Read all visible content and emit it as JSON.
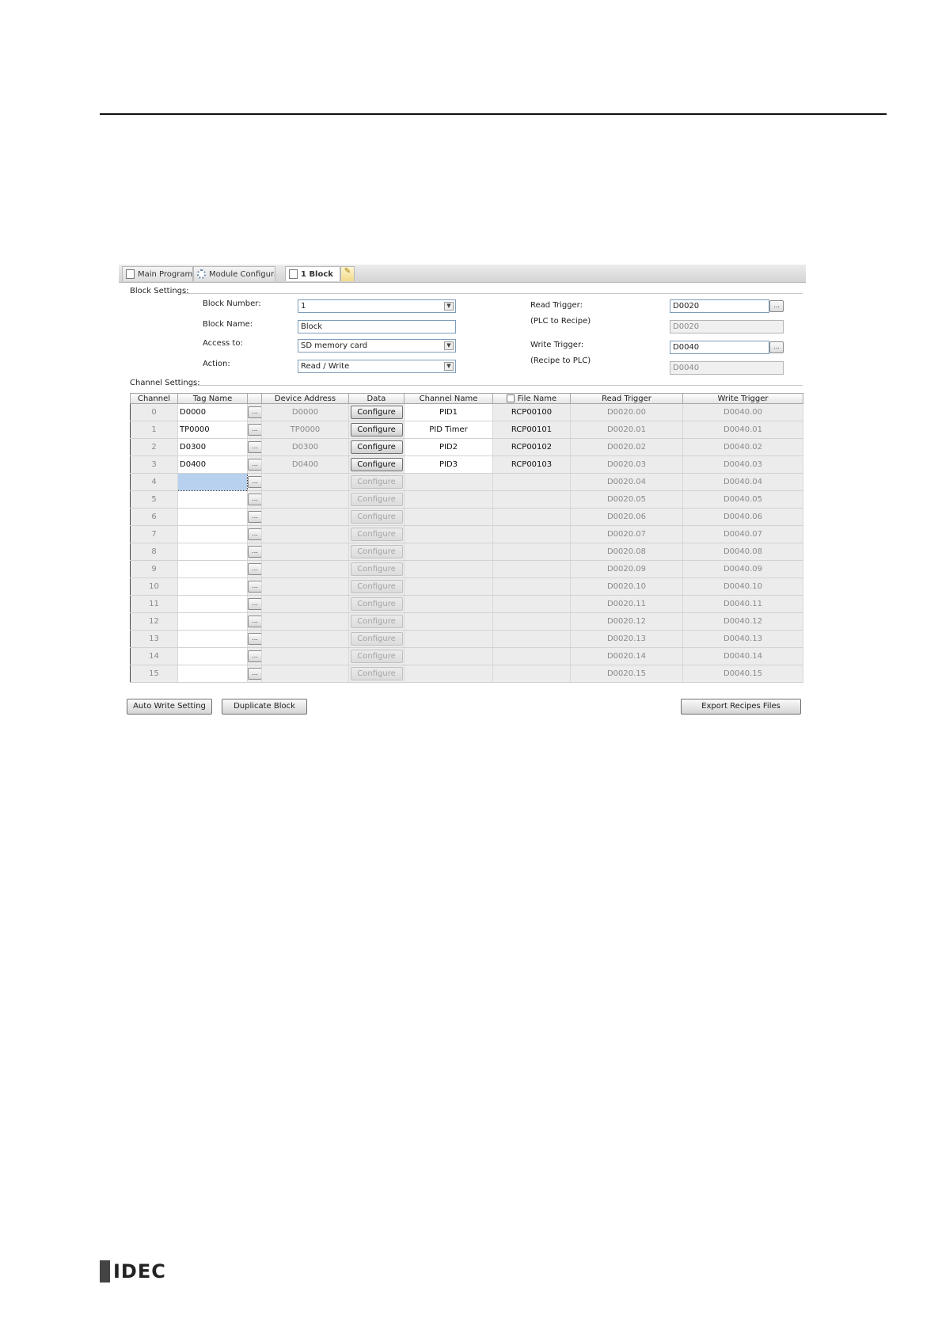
{
  "tabs": [
    {
      "label": "Main Program",
      "icon": "document-icon"
    },
    {
      "label": "Module Configurati",
      "icon": "gear-icon"
    },
    {
      "label": "1 Block",
      "icon": "recipe-icon"
    }
  ],
  "block_settings": {
    "title": "Block Settings:",
    "block_number_label": "Block Number:",
    "block_number_value": "1",
    "block_name_label": "Block Name:",
    "block_name_value": "Block",
    "access_to_label": "Access to:",
    "access_to_value": "SD memory card",
    "action_label": "Action:",
    "action_value": "Read / Write",
    "read_trigger_label": "Read Trigger:",
    "read_trigger_sub": "(PLC to Recipe)",
    "read_trigger_value": "D0020",
    "read_trigger_readonly": "D0020",
    "write_trigger_label": "Write Trigger:",
    "write_trigger_sub": "(Recipe to PLC)",
    "write_trigger_value": "D0040",
    "write_trigger_readonly": "D0040",
    "browse": "..."
  },
  "channel_settings": {
    "title": "Channel Settings:",
    "columns": [
      "Channel",
      "Tag Name",
      "",
      "Device Address",
      "Data",
      "Channel Name",
      "File Name",
      "Read Trigger",
      "Write Trigger"
    ],
    "browse": "...",
    "rows": [
      {
        "channel": "0",
        "tag": "D0000",
        "device": "D0000",
        "configure": "Configure",
        "channel_name": "PID1",
        "file_name": "RCP00100",
        "read": "D0020.00",
        "write": "D0040.00",
        "active": true
      },
      {
        "channel": "1",
        "tag": "TP0000",
        "device": "TP0000",
        "configure": "Configure",
        "channel_name": "PID Timer",
        "file_name": "RCP00101",
        "read": "D0020.01",
        "write": "D0040.01",
        "active": true
      },
      {
        "channel": "2",
        "tag": "D0300",
        "device": "D0300",
        "configure": "Configure",
        "channel_name": "PID2",
        "file_name": "RCP00102",
        "read": "D0020.02",
        "write": "D0040.02",
        "active": true
      },
      {
        "channel": "3",
        "tag": "D0400",
        "device": "D0400",
        "configure": "Configure",
        "channel_name": "PID3",
        "file_name": "RCP00103",
        "read": "D0020.03",
        "write": "D0040.03",
        "active": true
      },
      {
        "channel": "4",
        "tag": "",
        "device": "",
        "configure": "Configure",
        "channel_name": "",
        "file_name": "",
        "read": "D0020.04",
        "write": "D0040.04",
        "active": false
      },
      {
        "channel": "5",
        "tag": "",
        "device": "",
        "configure": "Configure",
        "channel_name": "",
        "file_name": "",
        "read": "D0020.05",
        "write": "D0040.05",
        "active": false
      },
      {
        "channel": "6",
        "tag": "",
        "device": "",
        "configure": "Configure",
        "channel_name": "",
        "file_name": "",
        "read": "D0020.06",
        "write": "D0040.06",
        "active": false
      },
      {
        "channel": "7",
        "tag": "",
        "device": "",
        "configure": "Configure",
        "channel_name": "",
        "file_name": "",
        "read": "D0020.07",
        "write": "D0040.07",
        "active": false
      },
      {
        "channel": "8",
        "tag": "",
        "device": "",
        "configure": "Configure",
        "channel_name": "",
        "file_name": "",
        "read": "D0020.08",
        "write": "D0040.08",
        "active": false
      },
      {
        "channel": "9",
        "tag": "",
        "device": "",
        "configure": "Configure",
        "channel_name": "",
        "file_name": "",
        "read": "D0020.09",
        "write": "D0040.09",
        "active": false
      },
      {
        "channel": "10",
        "tag": "",
        "device": "",
        "configure": "Configure",
        "channel_name": "",
        "file_name": "",
        "read": "D0020.10",
        "write": "D0040.10",
        "active": false
      },
      {
        "channel": "11",
        "tag": "",
        "device": "",
        "configure": "Configure",
        "channel_name": "",
        "file_name": "",
        "read": "D0020.11",
        "write": "D0040.11",
        "active": false
      },
      {
        "channel": "12",
        "tag": "",
        "device": "",
        "configure": "Configure",
        "channel_name": "",
        "file_name": "",
        "read": "D0020.12",
        "write": "D0040.12",
        "active": false
      },
      {
        "channel": "13",
        "tag": "",
        "device": "",
        "configure": "Configure",
        "channel_name": "",
        "file_name": "",
        "read": "D0020.13",
        "write": "D0040.13",
        "active": false
      },
      {
        "channel": "14",
        "tag": "",
        "device": "",
        "configure": "Configure",
        "channel_name": "",
        "file_name": "",
        "read": "D0020.14",
        "write": "D0040.14",
        "active": false
      },
      {
        "channel": "15",
        "tag": "",
        "device": "",
        "configure": "Configure",
        "channel_name": "",
        "file_name": "",
        "read": "D0020.15",
        "write": "D0040.15",
        "active": false
      }
    ]
  },
  "buttons": {
    "auto_write": "Auto Write Setting",
    "duplicate": "Duplicate Block",
    "export": "Export Recipes Files"
  },
  "logo": "IDEC"
}
